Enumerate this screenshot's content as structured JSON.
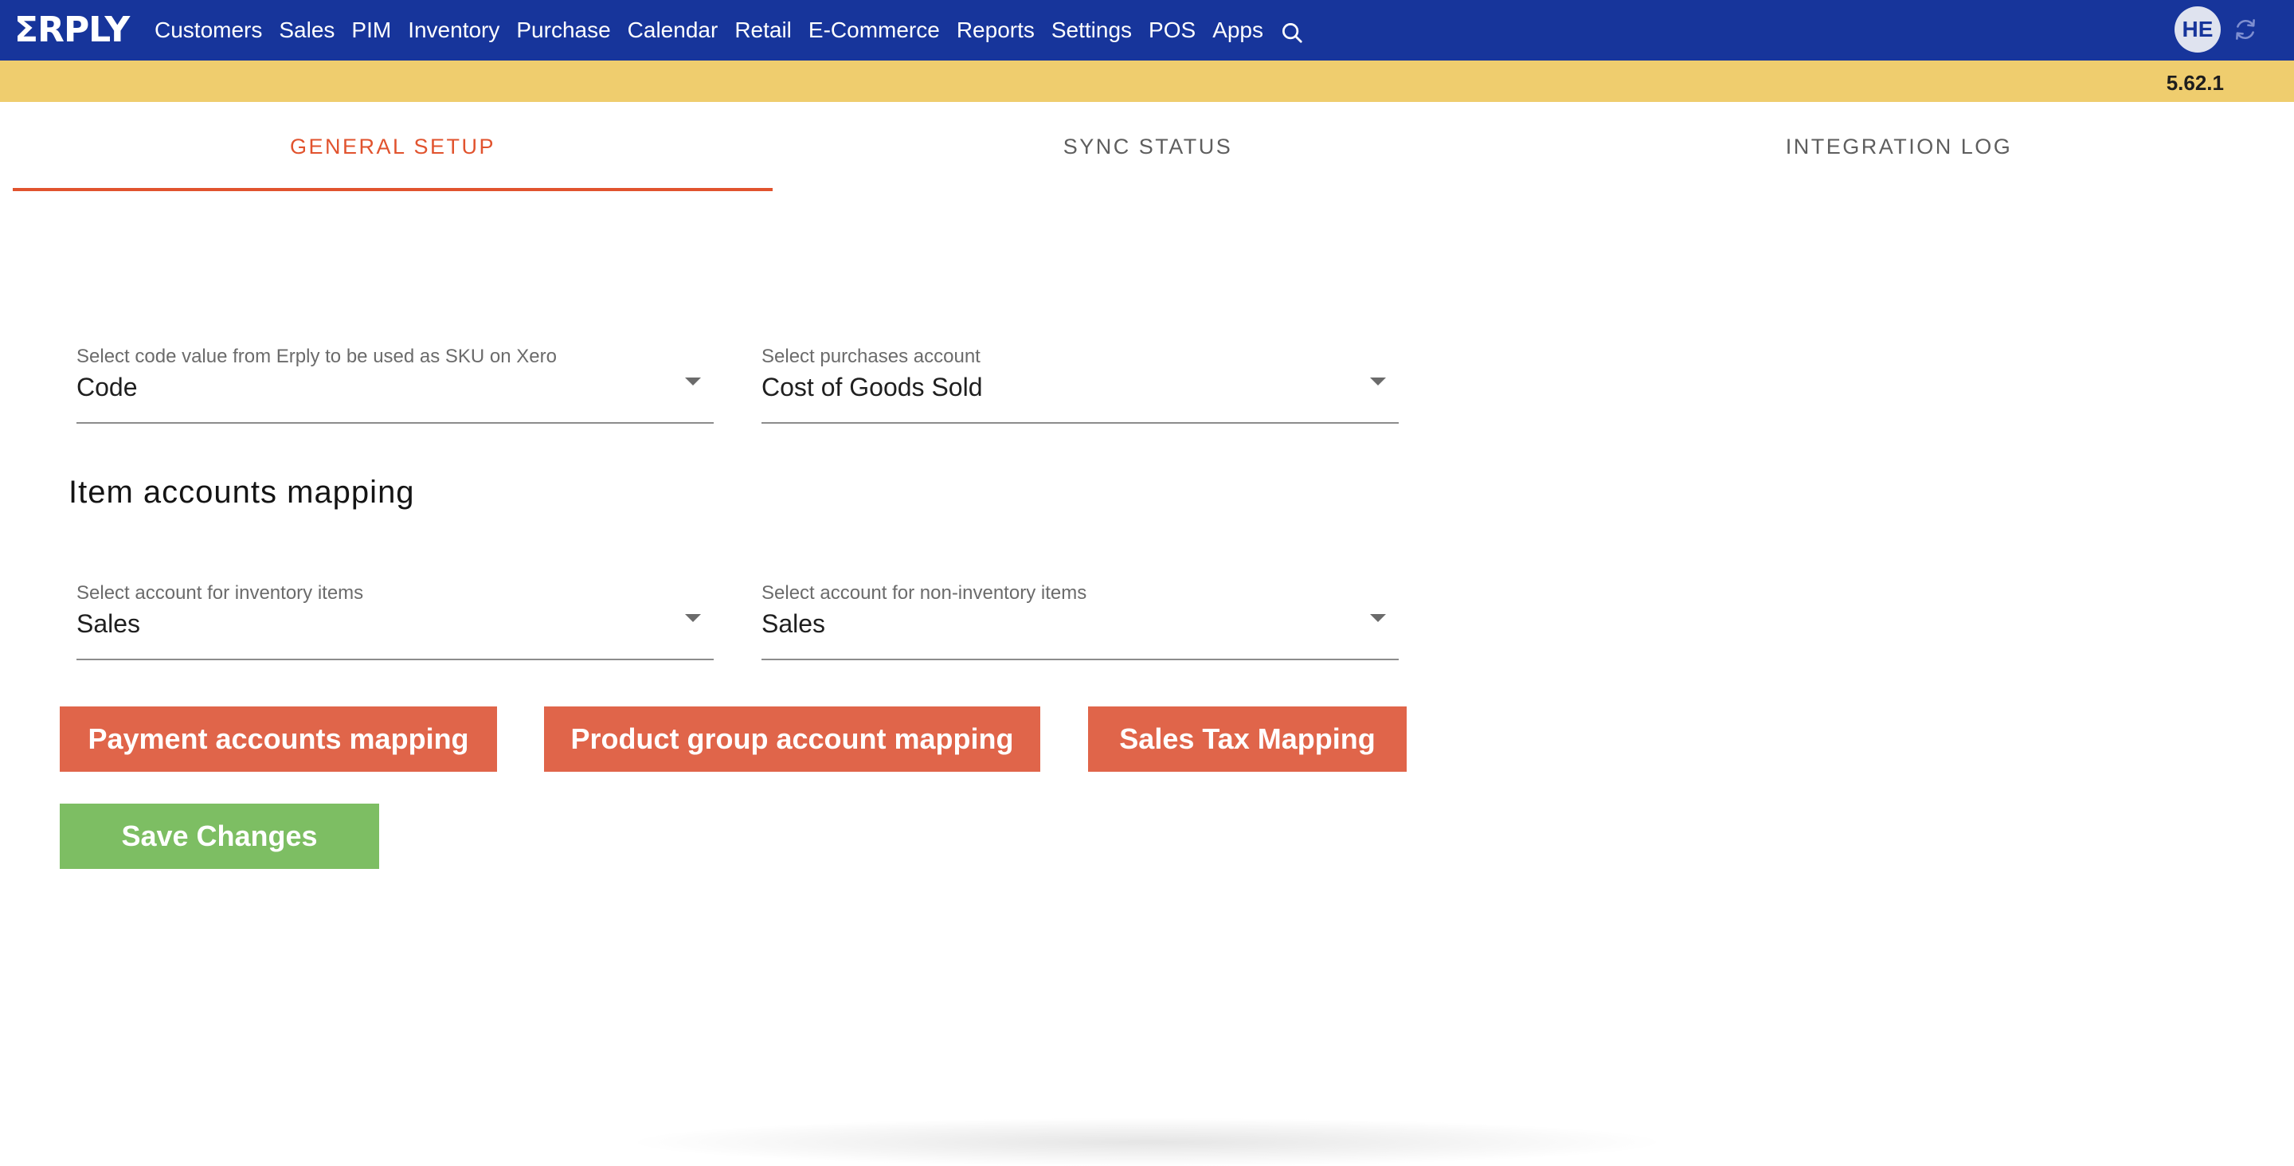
{
  "brand": {
    "logo_text": "ΣRPLY",
    "accent_color": "#17359b",
    "active_tab_color": "#e1532e"
  },
  "nav": {
    "items": [
      "Customers",
      "Sales",
      "PIM",
      "Inventory",
      "Purchase",
      "Calendar",
      "Retail",
      "E-Commerce",
      "Reports",
      "Settings",
      "POS",
      "Apps"
    ],
    "search_icon": "search-icon"
  },
  "user": {
    "initials": "HE",
    "refresh_icon": "refresh-icon"
  },
  "version": "5.62.1",
  "tabs": {
    "general": "GENERAL SETUP",
    "sync": "SYNC STATUS",
    "log": "INTEGRATION LOG",
    "active": "GENERAL SETUP"
  },
  "form": {
    "sku_code": {
      "label": "Select code value from Erply to be used as SKU on Xero",
      "value": "Code"
    },
    "purchases_account": {
      "label": "Select purchases account",
      "value": "Cost of Goods Sold"
    },
    "section_title": "Item accounts mapping",
    "inventory_account": {
      "label": "Select account for inventory items",
      "value": "Sales"
    },
    "non_inventory_account": {
      "label": "Select account for non-inventory items",
      "value": "Sales"
    }
  },
  "buttons": {
    "payment_mapping": "Payment accounts mapping",
    "product_group_mapping": "Product group account mapping",
    "sales_tax_mapping": "Sales Tax Mapping",
    "save": "Save Changes",
    "orange_color": "#e0654a",
    "green_color": "#7dbe63"
  }
}
